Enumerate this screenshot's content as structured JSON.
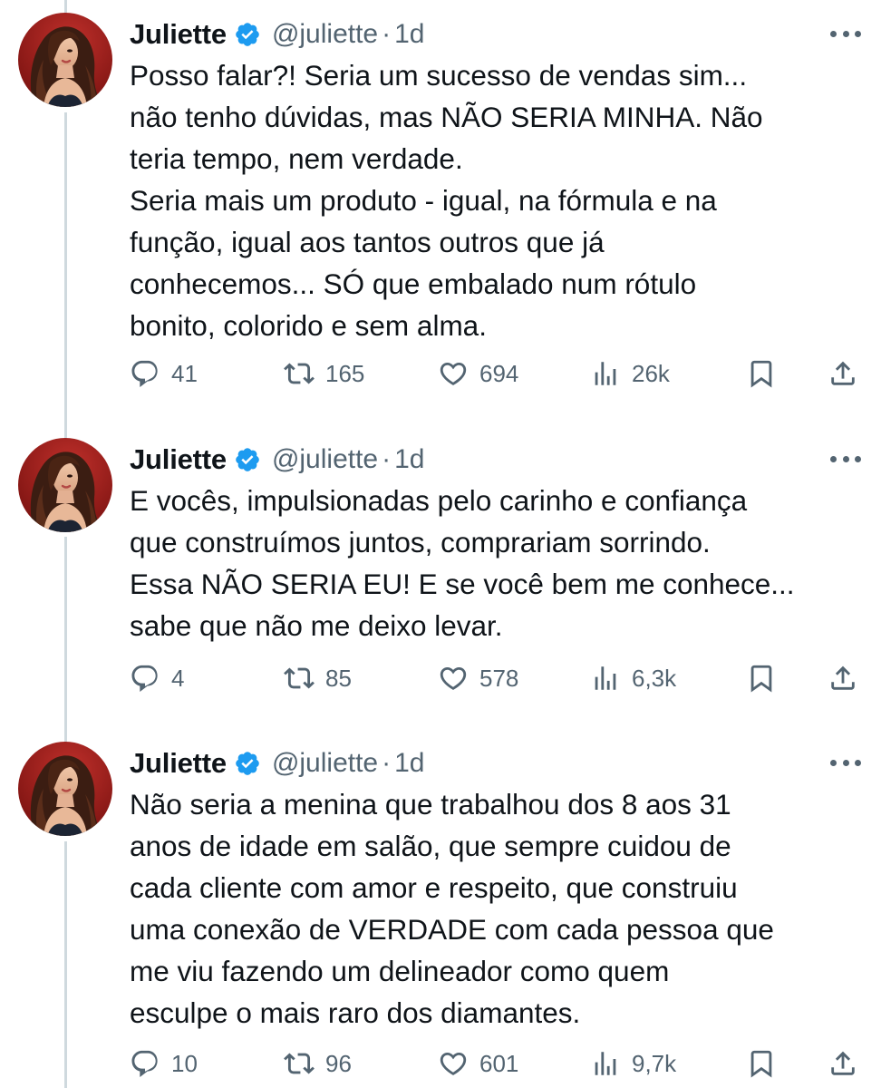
{
  "thread": {
    "tweets": [
      {
        "author": {
          "name": "Juliette",
          "handle": "@juliette",
          "verified": true,
          "avatar_icon": "profile-photo"
        },
        "separator": "·",
        "time": "1d",
        "more_icon": "more-horizontal-icon",
        "lines": [
          "Posso falar?! Seria um sucesso de vendas sim...",
          "não tenho dúvidas, mas NÃO SERIA MINHA. Não",
          "teria tempo, nem verdade.",
          "Seria mais um produto - igual, na fórmula e na",
          "função, igual aos tantos outros que já",
          "conhecemos... SÓ que embalado num rótulo",
          "bonito, colorido e sem alma."
        ],
        "stats": {
          "replies": "41",
          "retweets": "165",
          "likes": "694",
          "views": "26k"
        }
      },
      {
        "author": {
          "name": "Juliette",
          "handle": "@juliette",
          "verified": true,
          "avatar_icon": "profile-photo"
        },
        "separator": "·",
        "time": "1d",
        "more_icon": "more-horizontal-icon",
        "lines": [
          "E vocês, impulsionadas pelo carinho e confiança",
          "que construímos juntos, comprariam sorrindo.",
          "Essa NÃO SERIA EU! E se você bem me conhece...",
          "sabe que não me deixo levar."
        ],
        "stats": {
          "replies": "4",
          "retweets": "85",
          "likes": "578",
          "views": "6,3k"
        }
      },
      {
        "author": {
          "name": "Juliette",
          "handle": "@juliette",
          "verified": true,
          "avatar_icon": "profile-photo"
        },
        "separator": "·",
        "time": "1d",
        "more_icon": "more-horizontal-icon",
        "lines": [
          "Não seria a menina que trabalhou dos 8 aos 31",
          "anos de idade em salão, que sempre cuidou de",
          "cada cliente com amor e respeito, que construiu",
          "uma conexão de VERDADE com cada pessoa que",
          "me viu fazendo um delineador como quem",
          "esculpe o mais raro dos diamantes."
        ],
        "stats": {
          "replies": "10",
          "retweets": "96",
          "likes": "601",
          "views": "9,7k"
        }
      }
    ]
  },
  "icons": {
    "reply": "reply-icon",
    "retweet": "retweet-icon",
    "like": "heart-icon",
    "views": "views-icon",
    "bookmark": "bookmark-icon",
    "share": "share-icon",
    "verified": "verified-badge-icon"
  },
  "colors": {
    "verified_blue": "#1d9bf0",
    "secondary_text": "#536471",
    "primary_text": "#0f1419",
    "thread_line": "#cfd9de"
  }
}
